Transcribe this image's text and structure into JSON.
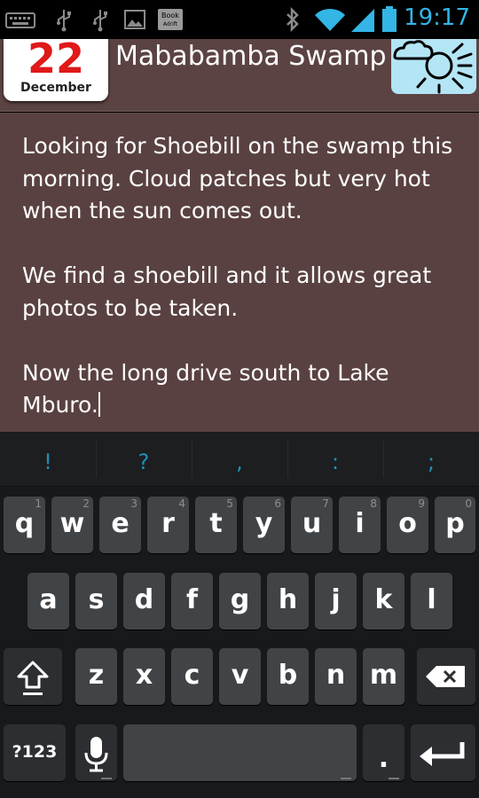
{
  "status_bar": {
    "time": "19:17",
    "icons": [
      "keyboard-icon",
      "usb-icon",
      "usb-icon",
      "image-icon",
      "app-icon",
      "bluetooth-icon",
      "wifi-icon",
      "signal-icon",
      "battery-icon"
    ],
    "app_icon_text": [
      "Book",
      "Adrift"
    ],
    "accent": "#33b5e5"
  },
  "header": {
    "date_day": "22",
    "date_month": "December",
    "title": "Mababamba Swamp",
    "weather_icon": "sun-cloud-icon"
  },
  "note": {
    "paragraphs": [
      "Looking for Shoebill on the swamp this morning. Cloud patches but very hot when the sun comes out.",
      "We find a shoebill and it allows great photos to be taken.",
      "Now the long drive south to Lake Mburo."
    ]
  },
  "keyboard": {
    "suggestions": [
      "!",
      "?",
      ",",
      ":",
      ";"
    ],
    "row1": [
      {
        "k": "q",
        "h": "1"
      },
      {
        "k": "w",
        "h": "2"
      },
      {
        "k": "e",
        "h": "3"
      },
      {
        "k": "r",
        "h": "4"
      },
      {
        "k": "t",
        "h": "5"
      },
      {
        "k": "y",
        "h": "6"
      },
      {
        "k": "u",
        "h": "7"
      },
      {
        "k": "i",
        "h": "8"
      },
      {
        "k": "o",
        "h": "9"
      },
      {
        "k": "p",
        "h": "0"
      }
    ],
    "row2": [
      "a",
      "s",
      "d",
      "f",
      "g",
      "h",
      "j",
      "k",
      "l"
    ],
    "row3": [
      "z",
      "x",
      "c",
      "v",
      "b",
      "n",
      "m"
    ],
    "symbols_label": "?123",
    "period_label": ".",
    "shift_icon": "shift-icon",
    "backspace_icon": "backspace-icon",
    "mic_icon": "microphone-icon",
    "enter_icon": "enter-icon"
  }
}
